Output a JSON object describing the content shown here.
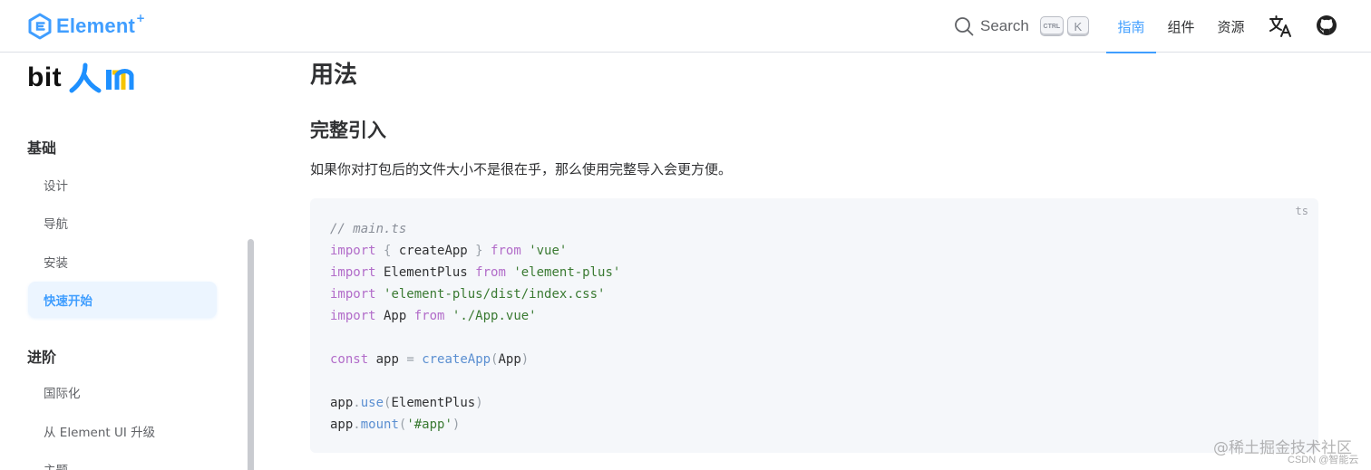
{
  "header": {
    "brand": "Element",
    "brand_plus": "+",
    "search_label": "Search",
    "search_key_ctrl": "CTRL",
    "search_key_k": "K",
    "nav": [
      {
        "label": "指南",
        "active": true
      },
      {
        "label": "组件",
        "active": false
      },
      {
        "label": "资源",
        "active": false
      }
    ],
    "icons": {
      "translate": "translate-icon",
      "github": "github-icon",
      "search": "search-icon"
    }
  },
  "sidebar": {
    "sponsor_logo_text": "bit",
    "groups": [
      {
        "title": "基础",
        "items": [
          {
            "label": "设计",
            "active": false
          },
          {
            "label": "导航",
            "active": false
          },
          {
            "label": "安装",
            "active": false
          },
          {
            "label": "快速开始",
            "active": true
          }
        ]
      },
      {
        "title": "进阶",
        "items": [
          {
            "label": "国际化",
            "active": false
          },
          {
            "label": "从 Element UI 升级",
            "active": false
          },
          {
            "label": "主题",
            "active": false
          }
        ]
      }
    ]
  },
  "main": {
    "title": "用法",
    "section_title": "完整引入",
    "paragraph": "如果你对打包后的文件大小不是很在乎，那么使用完整导入会更方便。",
    "code": {
      "lang": "ts",
      "lines": [
        [
          {
            "t": "// main.ts",
            "c": "comment"
          }
        ],
        [
          {
            "t": "import",
            "c": "kw"
          },
          {
            "t": " "
          },
          {
            "t": "{",
            "c": "punc"
          },
          {
            "t": " createApp "
          },
          {
            "t": "}",
            "c": "punc"
          },
          {
            "t": " "
          },
          {
            "t": "from",
            "c": "kw"
          },
          {
            "t": " "
          },
          {
            "t": "'vue'",
            "c": "str"
          }
        ],
        [
          {
            "t": "import",
            "c": "kw"
          },
          {
            "t": " ElementPlus "
          },
          {
            "t": "from",
            "c": "kw"
          },
          {
            "t": " "
          },
          {
            "t": "'element-plus'",
            "c": "str"
          }
        ],
        [
          {
            "t": "import",
            "c": "kw"
          },
          {
            "t": " "
          },
          {
            "t": "'element-plus/dist/index.css'",
            "c": "str"
          }
        ],
        [
          {
            "t": "import",
            "c": "kw"
          },
          {
            "t": " App "
          },
          {
            "t": "from",
            "c": "kw"
          },
          {
            "t": " "
          },
          {
            "t": "'./App.vue'",
            "c": "str"
          }
        ],
        [],
        [
          {
            "t": "const",
            "c": "kw"
          },
          {
            "t": " app "
          },
          {
            "t": "=",
            "c": "punc"
          },
          {
            "t": " "
          },
          {
            "t": "createApp",
            "c": "fn"
          },
          {
            "t": "(",
            "c": "punc"
          },
          {
            "t": "App"
          },
          {
            "t": ")",
            "c": "punc"
          }
        ],
        [],
        [
          {
            "t": "app"
          },
          {
            "t": ".",
            "c": "punc"
          },
          {
            "t": "use",
            "c": "fn"
          },
          {
            "t": "(",
            "c": "punc"
          },
          {
            "t": "ElementPlus"
          },
          {
            "t": ")",
            "c": "punc"
          }
        ],
        [
          {
            "t": "app"
          },
          {
            "t": ".",
            "c": "punc"
          },
          {
            "t": "mount",
            "c": "fn"
          },
          {
            "t": "(",
            "c": "punc"
          },
          {
            "t": "'#app'",
            "c": "str"
          },
          {
            "t": ")",
            "c": "punc"
          }
        ]
      ]
    }
  },
  "watermark": {
    "line1": "@稀土掘金技术社区",
    "line2": "CSDN @智能云"
  },
  "colors": {
    "accent": "#409eff",
    "code_bg": "#f5f7fa"
  }
}
